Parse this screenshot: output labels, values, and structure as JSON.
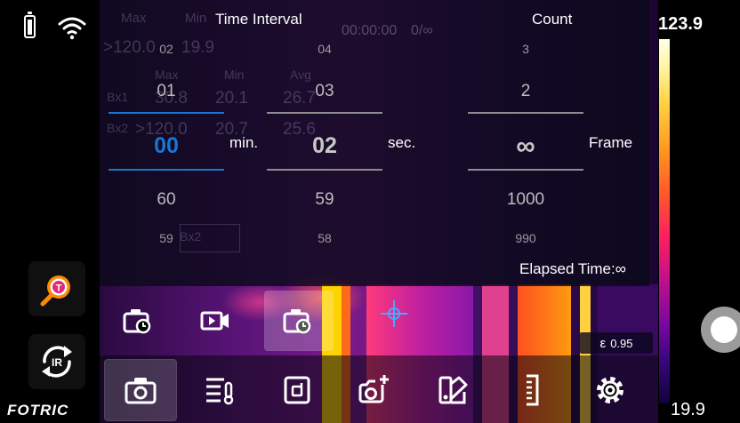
{
  "status": {
    "battery_icon": "battery-full-icon",
    "wifi_icon": "wifi-icon"
  },
  "brand": {
    "name": "FOTRIC"
  },
  "background_overlay": {
    "max_label": "Max",
    "min_label": "Min",
    "top_max": ">120.0",
    "top_min": "19.9",
    "record_time": "00:00:00",
    "record_count": "0/∞",
    "table_headers": {
      "max": "Max",
      "min": "Min",
      "avg": "Avg"
    },
    "bx1": {
      "label": "Bx1",
      "max": "30.8",
      "min": "20.1",
      "avg": "26.7"
    },
    "bx2": {
      "label": "Bx2",
      "max": ">120.0",
      "min": "20.7",
      "avg": "25.6"
    },
    "box_label": "Bx2"
  },
  "interval_picker": {
    "time_title": "Time Interval",
    "count_title": "Count",
    "minutes": {
      "top2": "02",
      "top1": "01",
      "selected": "00",
      "bottom1": "60",
      "bottom2": "59",
      "unit": "min."
    },
    "seconds": {
      "top2": "04",
      "top1": "03",
      "selected": "02",
      "bottom1": "59",
      "bottom2": "58",
      "unit": "sec."
    },
    "count": {
      "top2": "3",
      "top1": "2",
      "selected": "∞",
      "bottom1": "1000",
      "bottom2": "990",
      "unit": "Frame"
    },
    "elapsed": "Elapsed Time:∞"
  },
  "modes": [
    {
      "name": "interval-photo-mode",
      "icon": "camera-interval-icon",
      "selected": false
    },
    {
      "name": "video-mode",
      "icon": "video-camera-icon",
      "selected": false
    },
    {
      "name": "timed-capture-mode",
      "icon": "camera-timer-icon",
      "selected": true
    }
  ],
  "measure": {
    "emissivity_symbol": "ε",
    "emissivity_value": "0.95"
  },
  "toolbar": [
    {
      "name": "camera-tool",
      "icon": "camera-icon",
      "selected": true
    },
    {
      "name": "analysis-list-tool",
      "icon": "list-thermometer-icon",
      "selected": false
    },
    {
      "name": "image-fusion-tool",
      "icon": "fusion-icon",
      "selected": false
    },
    {
      "name": "add-analysis-tool",
      "icon": "camera-plus-icon",
      "selected": false
    },
    {
      "name": "palette-tool",
      "icon": "palette-icon",
      "selected": false
    },
    {
      "name": "range-tool",
      "icon": "ruler-icon",
      "selected": false
    },
    {
      "name": "settings-tool",
      "icon": "gear-icon",
      "selected": false
    }
  ],
  "scale": {
    "max": "123.9",
    "min": "19.9"
  },
  "colors": {
    "accent_blue": "#1976d2",
    "overlay": "#0c0a1c",
    "logo_orange": "#ff8a00"
  }
}
